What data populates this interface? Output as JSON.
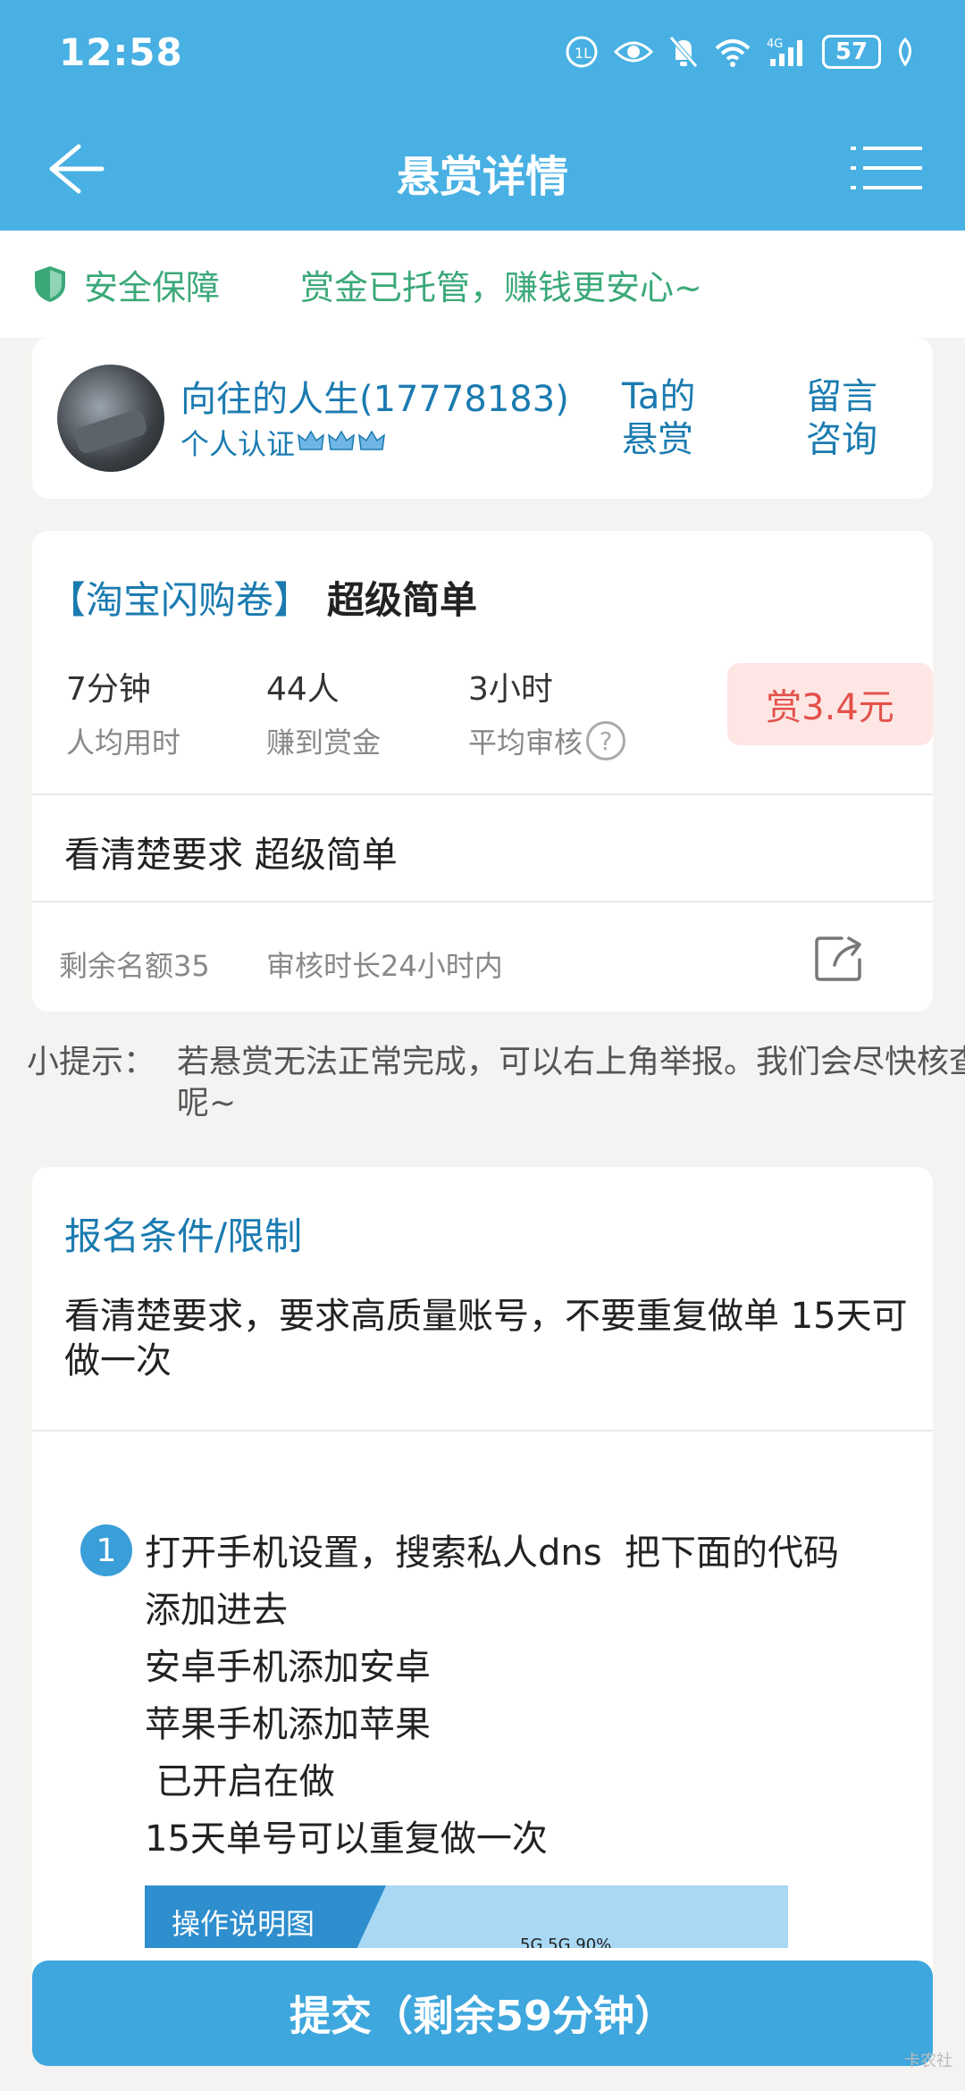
{
  "status_bar": {
    "time": "12:58",
    "battery": "57",
    "network": "4G"
  },
  "nav": {
    "title": "悬赏详情"
  },
  "safety": {
    "label": "安全保障",
    "message": "赏金已托管，赚钱更安心~"
  },
  "publisher": {
    "name": "向往的人生(17778183)",
    "certification": "个人认证",
    "ta_reward": "Ta的悬赏",
    "consult": "留言咨询"
  },
  "task": {
    "tag": "【淘宝闪购卷】",
    "name": "超级简单",
    "stats": [
      {
        "value": "7分钟",
        "label": "人均用时"
      },
      {
        "value": "44人",
        "label": "赚到赏金"
      },
      {
        "value": "3小时",
        "label": "平均审核"
      }
    ],
    "help_mark": "?",
    "reward": "赏3.4元",
    "description": "看清楚要求 超级简单",
    "quota": "剩余名额35",
    "review_time": "审核时长24小时内"
  },
  "tip": {
    "label": "小提示：",
    "text": "若悬赏无法正常完成，可以右上角举报。我们会尽快核查呢~"
  },
  "requirements": {
    "title": "报名条件/限制",
    "body": "看清楚要求，要求高质量账号，不要重复做单 15天可做一次",
    "step_number": "1",
    "step_lines": [
      "打开手机设置，搜索私人dns  把下面的代码",
      "添加进去",
      "安卓手机添加安卓",
      "苹果手机添加苹果",
      " 已开启在做",
      "15天单号可以重复做一次"
    ],
    "guide_label": "操作说明图",
    "guide_status": "5G 5G 90%"
  },
  "submit_label": "提交（剩余59分钟）",
  "watermark": "卡农社",
  "colors": {
    "primary": "#48b0e3",
    "link": "#1b7bb0",
    "safe_green": "#3ba878",
    "reward_red": "#e3514a"
  }
}
